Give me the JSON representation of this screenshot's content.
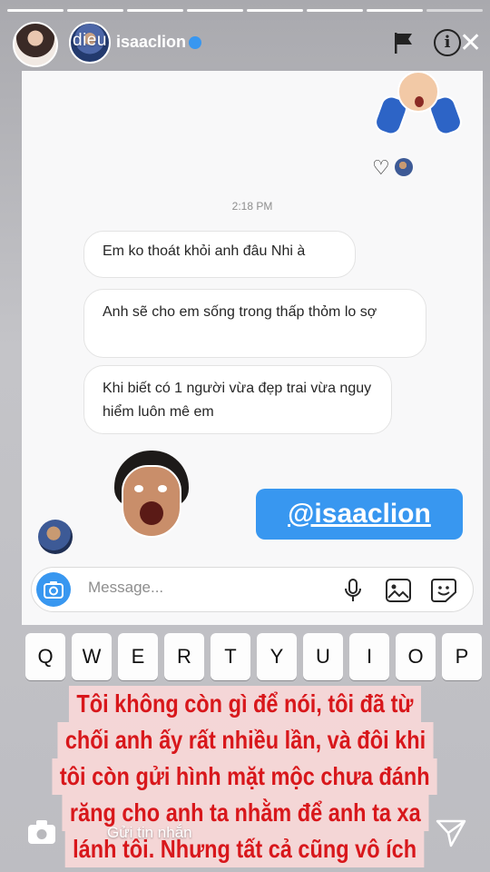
{
  "header": {
    "name_overlay": "dieu",
    "handle": "isaaclion",
    "icons": [
      "flag-icon",
      "info-icon",
      "close-icon"
    ]
  },
  "progress_segments": 8,
  "dm": {
    "timestamp": "2:18 PM",
    "messages": [
      "Em ko thoát khỏi anh đâu Nhi à",
      "Anh sẽ cho em sống trong thấp thỏm lo sợ",
      "Khi biết có 1 người vừa đẹp trai vừa nguy hiểm luôn mê em"
    ],
    "mention": "@isaaclion",
    "composer_placeholder": "Message..."
  },
  "keyboard": {
    "row1": [
      "Q",
      "W",
      "E",
      "R",
      "T",
      "Y",
      "U",
      "I",
      "O",
      "P"
    ]
  },
  "caption": {
    "lines": [
      "Tôi không còn gì để nói, tôi đã từ",
      "chối anh ấy rất nhiều lần, và đôi khi",
      "tôi còn gửi hình mặt mộc chưa đánh",
      "răng cho anh ta nhằm để anh ta xa",
      "lánh tôi. Nhưng tất cả cũng vô ích"
    ]
  },
  "reply_bar": {
    "label": "Gửi tin nhắn"
  },
  "colors": {
    "accent_blue": "#3897f0",
    "caption_red": "#d8171b",
    "caption_bg": "#f8d8d8"
  }
}
